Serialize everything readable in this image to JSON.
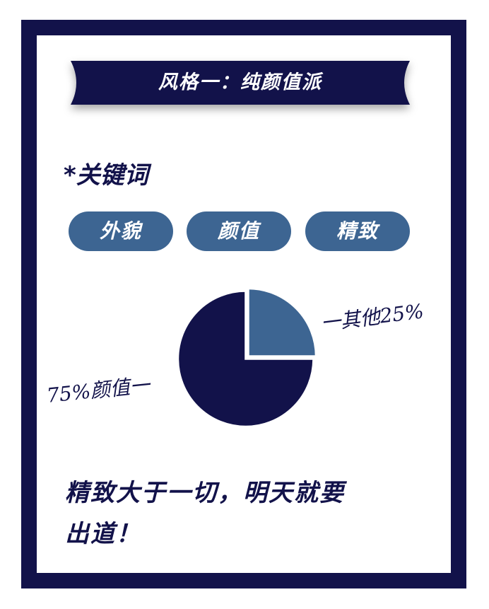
{
  "banner": {
    "title": "风格一：纯颜值派"
  },
  "keywords": {
    "heading": "*关键词",
    "items": [
      "外貌",
      "颜值",
      "精致"
    ]
  },
  "chart_data": {
    "type": "pie",
    "slices": [
      {
        "label": "其他",
        "value": 25,
        "color": "#3d6592",
        "annotation": "一其他25%"
      },
      {
        "label": "颜值",
        "value": 75,
        "color": "#12124a",
        "annotation": "75%颜值一"
      }
    ]
  },
  "footer": {
    "line1": "精致大于一切，明天就要",
    "line2": "出道！"
  },
  "colors": {
    "navy": "#12124a",
    "steel_blue": "#3d6592",
    "background": "#ffffff"
  }
}
